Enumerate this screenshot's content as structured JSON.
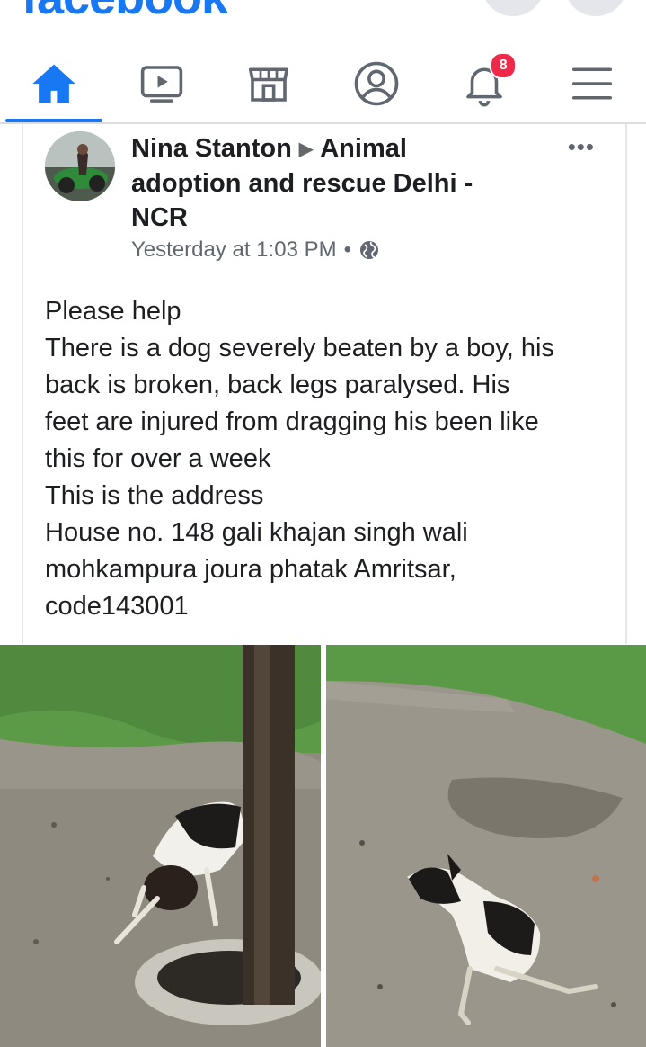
{
  "app": {
    "brand": "facebook"
  },
  "nav": {
    "tabs": [
      {
        "name": "home",
        "icon": "home-icon",
        "active": true
      },
      {
        "name": "watch",
        "icon": "video-icon"
      },
      {
        "name": "marketplace",
        "icon": "marketplace-icon"
      },
      {
        "name": "profile",
        "icon": "profile-icon"
      },
      {
        "name": "notifications",
        "icon": "bell-icon",
        "badge": "8"
      },
      {
        "name": "menu",
        "icon": "menu-icon"
      }
    ]
  },
  "post": {
    "author": "Nina Stanton",
    "group": "Animal adoption and rescue Delhi - NCR",
    "timestamp": "Yesterday at 1:03 PM",
    "dot": "•",
    "privacy_icon": "globe-icon",
    "more": "•••",
    "body_lines": [
      "Please help",
      "There is a dog severely beaten by a boy, his",
      "back is broken, back legs paralysed. His",
      "feet are injured from dragging his been like",
      "this for over a week",
      "This is the address",
      "House no. 148 gali khajan singh wali",
      "mohkampura joura phatak Amritsar,",
      "code143001"
    ]
  },
  "colors": {
    "accent": "#1877f2",
    "badge": "#f02849",
    "text": "#1c1e21",
    "meta": "#606770"
  }
}
